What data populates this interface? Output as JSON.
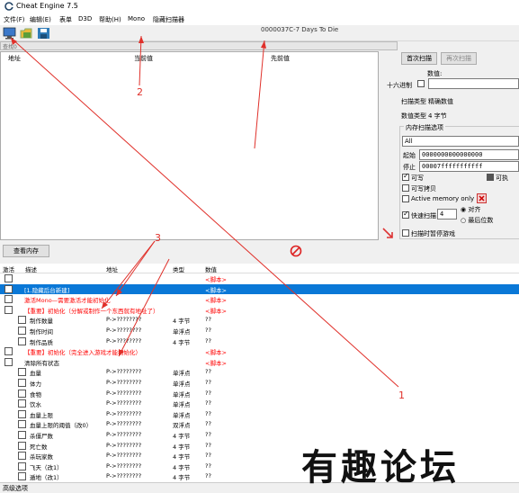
{
  "window": {
    "title": "Cheat Engine 7.5",
    "icon": "cheat-engine-logo-icon"
  },
  "menu": [
    "文件(F)",
    "编辑(E)",
    "表单",
    "D3D",
    "帮助(H)",
    "Mono",
    "隐藏扫描器"
  ],
  "toolbar": {
    "process": "0000037C-7 Days To Die"
  },
  "progress": {
    "label": "查找0"
  },
  "results_headers": [
    "地址",
    "当前值",
    "先前值"
  ],
  "scan": {
    "first_scan": "首次扫描",
    "next_scan": "再次扫描",
    "value_label": "数值:",
    "hex_label": "十六进制",
    "scan_type_label": "扫描类型",
    "scan_type": "精确数值",
    "value_type_label": "数值类型",
    "value_type": "4 字节",
    "mem_options": "内存扫描选项",
    "mem_all": "All",
    "start_label": "起始",
    "start": "0000000000000000",
    "stop_label": "停止",
    "stop": "00007fffffffffff",
    "writable": "可写",
    "executable": "可执",
    "copy_on_write": "可写拷贝",
    "active_memory": "Active memory only",
    "fast_scan": "快速扫描",
    "fast_val": "4",
    "align": "对齐",
    "last_digits": "最后位数",
    "pause": "扫描时暂停游戏"
  },
  "bottom": {
    "view_memory": "查看内存"
  },
  "address_headers": [
    "激活",
    "描述",
    "地址",
    "类型",
    "数值"
  ],
  "rows": [
    {
      "desc": "",
      "addr": "",
      "type": "",
      "value": "<脚本>",
      "color": "#ff0000",
      "cb": false
    },
    {
      "desc": "[1.隐藏后台新建]",
      "addr": "",
      "type": "",
      "value": "<脚本>",
      "color": "#7fff00",
      "cb": false,
      "sel": true
    },
    {
      "desc": "激活Mono—需要激活才能初始化",
      "addr": "",
      "type": "",
      "value": "<脚本>",
      "color": "#ff0000",
      "cb": false
    },
    {
      "desc": "【重要】初始化（分解或制作一个东西就有地址了）",
      "addr": "",
      "type": "",
      "value": "<脚本>",
      "color": "#ff0000",
      "cb": true
    },
    {
      "desc": "制作数量",
      "addr": "P->????????",
      "type": "4 字节",
      "value": "??",
      "color": "#000",
      "cb": false,
      "indent": true
    },
    {
      "desc": "制作时间",
      "addr": "P->????????",
      "type": "单浮点",
      "value": "??",
      "color": "#000",
      "cb": false,
      "indent": true
    },
    {
      "desc": "制作品质",
      "addr": "P->????????",
      "type": "4 字节",
      "value": "??",
      "color": "#000",
      "cb": false,
      "indent": true
    },
    {
      "desc": "【重要】初始化（完全进入游戏才能初始化）",
      "addr": "",
      "type": "",
      "value": "<脚本>",
      "color": "#ff0000",
      "cb": true
    },
    {
      "desc": "清除所有状态",
      "addr": "",
      "type": "",
      "value": "<脚本>",
      "color": "#000",
      "cb": true
    },
    {
      "desc": "血量",
      "addr": "P->????????",
      "type": "单浮点",
      "value": "??",
      "color": "#000",
      "cb": false,
      "indent": true
    },
    {
      "desc": "体力",
      "addr": "P->????????",
      "type": "单浮点",
      "value": "??",
      "color": "#000",
      "cb": false,
      "indent": true
    },
    {
      "desc": "食物",
      "addr": "P->????????",
      "type": "单浮点",
      "value": "??",
      "color": "#000",
      "cb": false,
      "indent": true
    },
    {
      "desc": "饮水",
      "addr": "P->????????",
      "type": "单浮点",
      "value": "??",
      "color": "#000",
      "cb": false,
      "indent": true
    },
    {
      "desc": "血量上限",
      "addr": "P->????????",
      "type": "单浮点",
      "value": "??",
      "color": "#000",
      "cb": false,
      "indent": true
    },
    {
      "desc": "血量上限的阈值（改0）",
      "addr": "P->????????",
      "type": "双浮点",
      "value": "??",
      "color": "#000",
      "cb": false,
      "indent": true
    },
    {
      "desc": "杀僵尸数",
      "addr": "P->????????",
      "type": "4 字节",
      "value": "??",
      "color": "#000",
      "cb": false,
      "indent": true
    },
    {
      "desc": "死亡数",
      "addr": "P->????????",
      "type": "4 字节",
      "value": "??",
      "color": "#000",
      "cb": false,
      "indent": true
    },
    {
      "desc": "杀玩家数",
      "addr": "P->????????",
      "type": "4 字节",
      "value": "??",
      "color": "#000",
      "cb": false,
      "indent": true
    },
    {
      "desc": "飞天（改1）",
      "addr": "P->????????",
      "type": "4 字节",
      "value": "??",
      "color": "#000",
      "cb": false,
      "indent": true
    },
    {
      "desc": "遁地（改1）",
      "addr": "P->????????",
      "type": "4 字节",
      "value": "??",
      "color": "#000",
      "cb": false,
      "indent": true
    }
  ],
  "status": {
    "advanced": "高级选项"
  },
  "watermark": "有趣论坛",
  "annotations": [
    "2",
    "3",
    "1"
  ],
  "colors": {
    "selection": "#0a78d7",
    "annotation": "#e0302a"
  }
}
